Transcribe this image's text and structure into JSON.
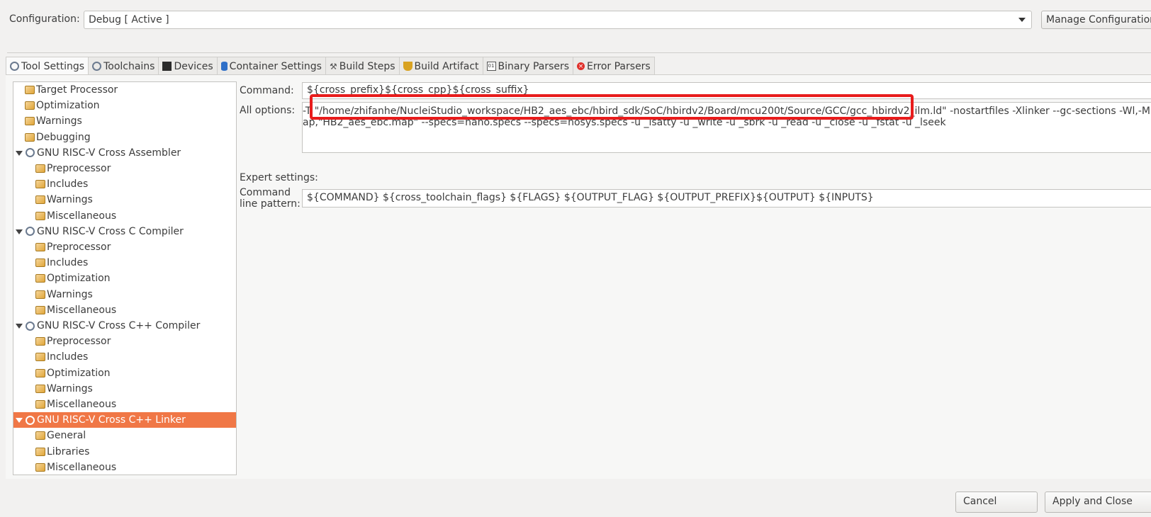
{
  "config": {
    "label": "Configuration:",
    "value": "Debug  [ Active ]",
    "manage_button": "Manage Configurations..."
  },
  "tabs": [
    {
      "label": "Tool Settings",
      "icon": "tool-settings-icon",
      "active": true
    },
    {
      "label": "Toolchains",
      "icon": "toolchains-icon"
    },
    {
      "label": "Devices",
      "icon": "chip-icon"
    },
    {
      "label": "Container Settings",
      "icon": "container-icon"
    },
    {
      "label": "Build Steps",
      "icon": "hammer-icon"
    },
    {
      "label": "Build Artifact",
      "icon": "trophy-icon"
    },
    {
      "label": "Binary Parsers",
      "icon": "binary-icon"
    },
    {
      "label": "Error Parsers",
      "icon": "error-icon"
    }
  ],
  "tree": [
    {
      "label": "Target Processor",
      "kind": "leaf",
      "level": 0
    },
    {
      "label": "Optimization",
      "kind": "leaf",
      "level": 0
    },
    {
      "label": "Warnings",
      "kind": "leaf",
      "level": 0
    },
    {
      "label": "Debugging",
      "kind": "leaf",
      "level": 0
    },
    {
      "label": "GNU RISC-V Cross Assembler",
      "kind": "tool",
      "level": 0
    },
    {
      "label": "Preprocessor",
      "kind": "leaf",
      "level": 1
    },
    {
      "label": "Includes",
      "kind": "leaf",
      "level": 1
    },
    {
      "label": "Warnings",
      "kind": "leaf",
      "level": 1
    },
    {
      "label": "Miscellaneous",
      "kind": "leaf",
      "level": 1
    },
    {
      "label": "GNU RISC-V Cross C Compiler",
      "kind": "tool",
      "level": 0
    },
    {
      "label": "Preprocessor",
      "kind": "leaf",
      "level": 1
    },
    {
      "label": "Includes",
      "kind": "leaf",
      "level": 1
    },
    {
      "label": "Optimization",
      "kind": "leaf",
      "level": 1
    },
    {
      "label": "Warnings",
      "kind": "leaf",
      "level": 1
    },
    {
      "label": "Miscellaneous",
      "kind": "leaf",
      "level": 1
    },
    {
      "label": "GNU RISC-V Cross C++ Compiler",
      "kind": "tool",
      "level": 0
    },
    {
      "label": "Preprocessor",
      "kind": "leaf",
      "level": 1
    },
    {
      "label": "Includes",
      "kind": "leaf",
      "level": 1
    },
    {
      "label": "Optimization",
      "kind": "leaf",
      "level": 1
    },
    {
      "label": "Warnings",
      "kind": "leaf",
      "level": 1
    },
    {
      "label": "Miscellaneous",
      "kind": "leaf",
      "level": 1
    },
    {
      "label": "GNU RISC-V Cross C++ Linker",
      "kind": "tool",
      "level": 0,
      "selected": true
    },
    {
      "label": "General",
      "kind": "leaf",
      "level": 1
    },
    {
      "label": "Libraries",
      "kind": "leaf",
      "level": 1
    },
    {
      "label": "Miscellaneous",
      "kind": "leaf",
      "level": 1
    }
  ],
  "settings": {
    "command_label": "Command:",
    "command_value": "${cross_prefix}${cross_cpp}${cross_suffix}",
    "all_options_label": "All options:",
    "all_options_value": "-T \"/home/zhifanhe/NucleiStudio_workspace/HB2_aes_ebc/hbird_sdk/SoC/hbirdv2/Board/mcu200t/Source/GCC/gcc_hbirdv2_ilm.ld\" -nostartfiles -Xlinker --gc-sections -Wl,-Map,\"HB2_aes_ebc.map\" --specs=nano.specs --specs=nosys.specs -u _isatty -u _write -u _sbrk -u _read -u _close -u _fstat -u _lseek",
    "expert_label": "Expert settings:",
    "pattern_label": "Command line pattern:",
    "pattern_value": "${COMMAND} ${cross_toolchain_flags} ${FLAGS} ${OUTPUT_FLAG} ${OUTPUT_PREFIX}${OUTPUT} ${INPUTS}"
  },
  "buttons": {
    "cancel": "Cancel",
    "apply_close": "Apply and Close"
  },
  "colors": {
    "selection": "#f07746",
    "highlight_box": "#e81c1c"
  }
}
